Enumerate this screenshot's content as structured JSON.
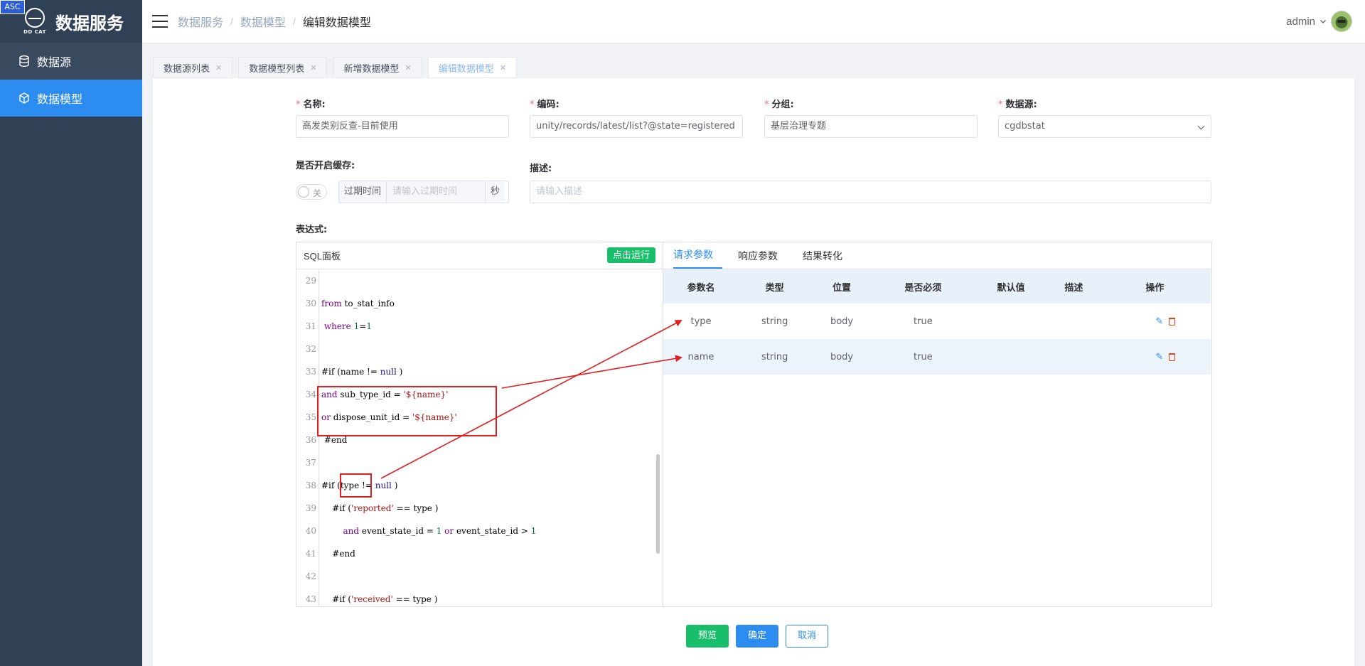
{
  "app": {
    "title": "数据服务",
    "logo_tag": "DD CAT",
    "badge": "ASC"
  },
  "sidebar": {
    "items": [
      {
        "label": "数据源",
        "icon": "database-icon"
      },
      {
        "label": "数据模型",
        "icon": "cube-icon"
      }
    ]
  },
  "breadcrumb": [
    "数据服务",
    "数据模型",
    "编辑数据模型"
  ],
  "user": {
    "name": "admin"
  },
  "tabs": [
    {
      "label": "数据源列表"
    },
    {
      "label": "数据模型列表"
    },
    {
      "label": "新增数据模型"
    },
    {
      "label": "编辑数据模型"
    }
  ],
  "form": {
    "name_label": "名称:",
    "name_value": "高发类别反查-目前使用",
    "code_label": "编码:",
    "code_value": "unity/records/latest/list?@state=registered",
    "group_label": "分组:",
    "group_value": "基层治理专题",
    "datasource_label": "数据源:",
    "datasource_value": "cgdbstat",
    "cache_label": "是否开启缓存:",
    "cache_switch_text": "关",
    "expire_prefix": "过期时间",
    "expire_placeholder": "请输入过期时间",
    "expire_suffix": "秒",
    "desc_label": "描述:",
    "desc_placeholder": "请输入描述",
    "expr_label": "表达式:"
  },
  "sql": {
    "title": "SQL面板",
    "run_label": "点击运行"
  },
  "params": {
    "tabs": [
      "请求参数",
      "响应参数",
      "结果转化"
    ],
    "columns": [
      "参数名",
      "类型",
      "位置",
      "是否必须",
      "默认值",
      "描述",
      "操作"
    ],
    "rows": [
      {
        "name": "type",
        "type": "string",
        "position": "body",
        "required": "true",
        "default": "",
        "desc": ""
      },
      {
        "name": "name",
        "type": "string",
        "position": "body",
        "required": "true",
        "default": "",
        "desc": ""
      }
    ]
  },
  "buttons": {
    "preview": "预览",
    "confirm": "确定",
    "cancel": "取消"
  },
  "colors": {
    "sidebar_bg": "#304156",
    "accent": "#2d8cf0",
    "success": "#19be6b",
    "annotation": "#e02020"
  }
}
